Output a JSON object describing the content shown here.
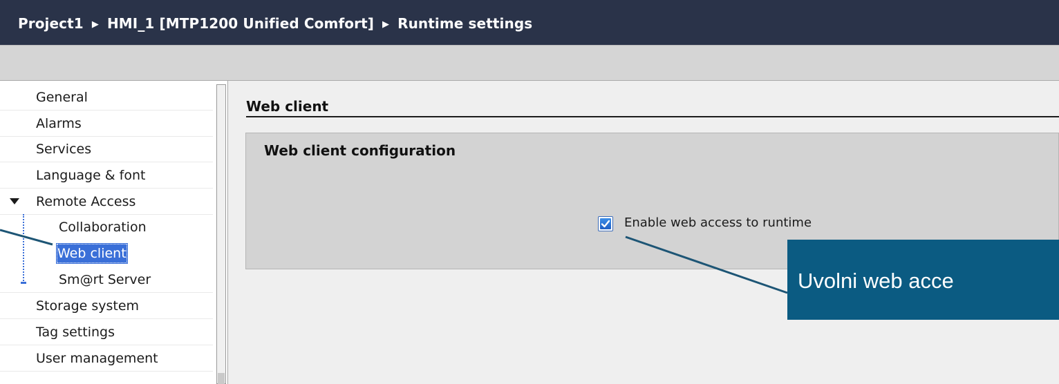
{
  "breadcrumb": {
    "items": [
      "Project1",
      "HMI_1 [MTP1200 Unified Comfort]",
      "Runtime settings"
    ],
    "separator": "▶"
  },
  "nav": {
    "items": [
      {
        "label": "General"
      },
      {
        "label": "Alarms"
      },
      {
        "label": "Services"
      },
      {
        "label": "Language & font"
      },
      {
        "label": "Remote Access",
        "expanded": true
      },
      {
        "label": "Collaboration"
      },
      {
        "label": "Web client",
        "selected": true
      },
      {
        "label": "Sm@rt Server"
      },
      {
        "label": "Storage system"
      },
      {
        "label": "Tag settings"
      },
      {
        "label": "User management"
      }
    ]
  },
  "main": {
    "section_title": "Web client",
    "group_title": "Web client configuration",
    "checkbox": {
      "label": "Enable web access to runtime",
      "checked": true
    }
  },
  "callout": {
    "text": "Uvolni web acce"
  },
  "colors": {
    "title_bar": "#2a3349",
    "selection": "#3a6fd8",
    "callout": "#0b5b82",
    "leader_line": "#1d5575"
  },
  "icons": {
    "breadcrumb_separator": "chevron-right-icon",
    "tree_toggle": "triangle-down-icon",
    "checkbox": "checkmark-icon"
  }
}
